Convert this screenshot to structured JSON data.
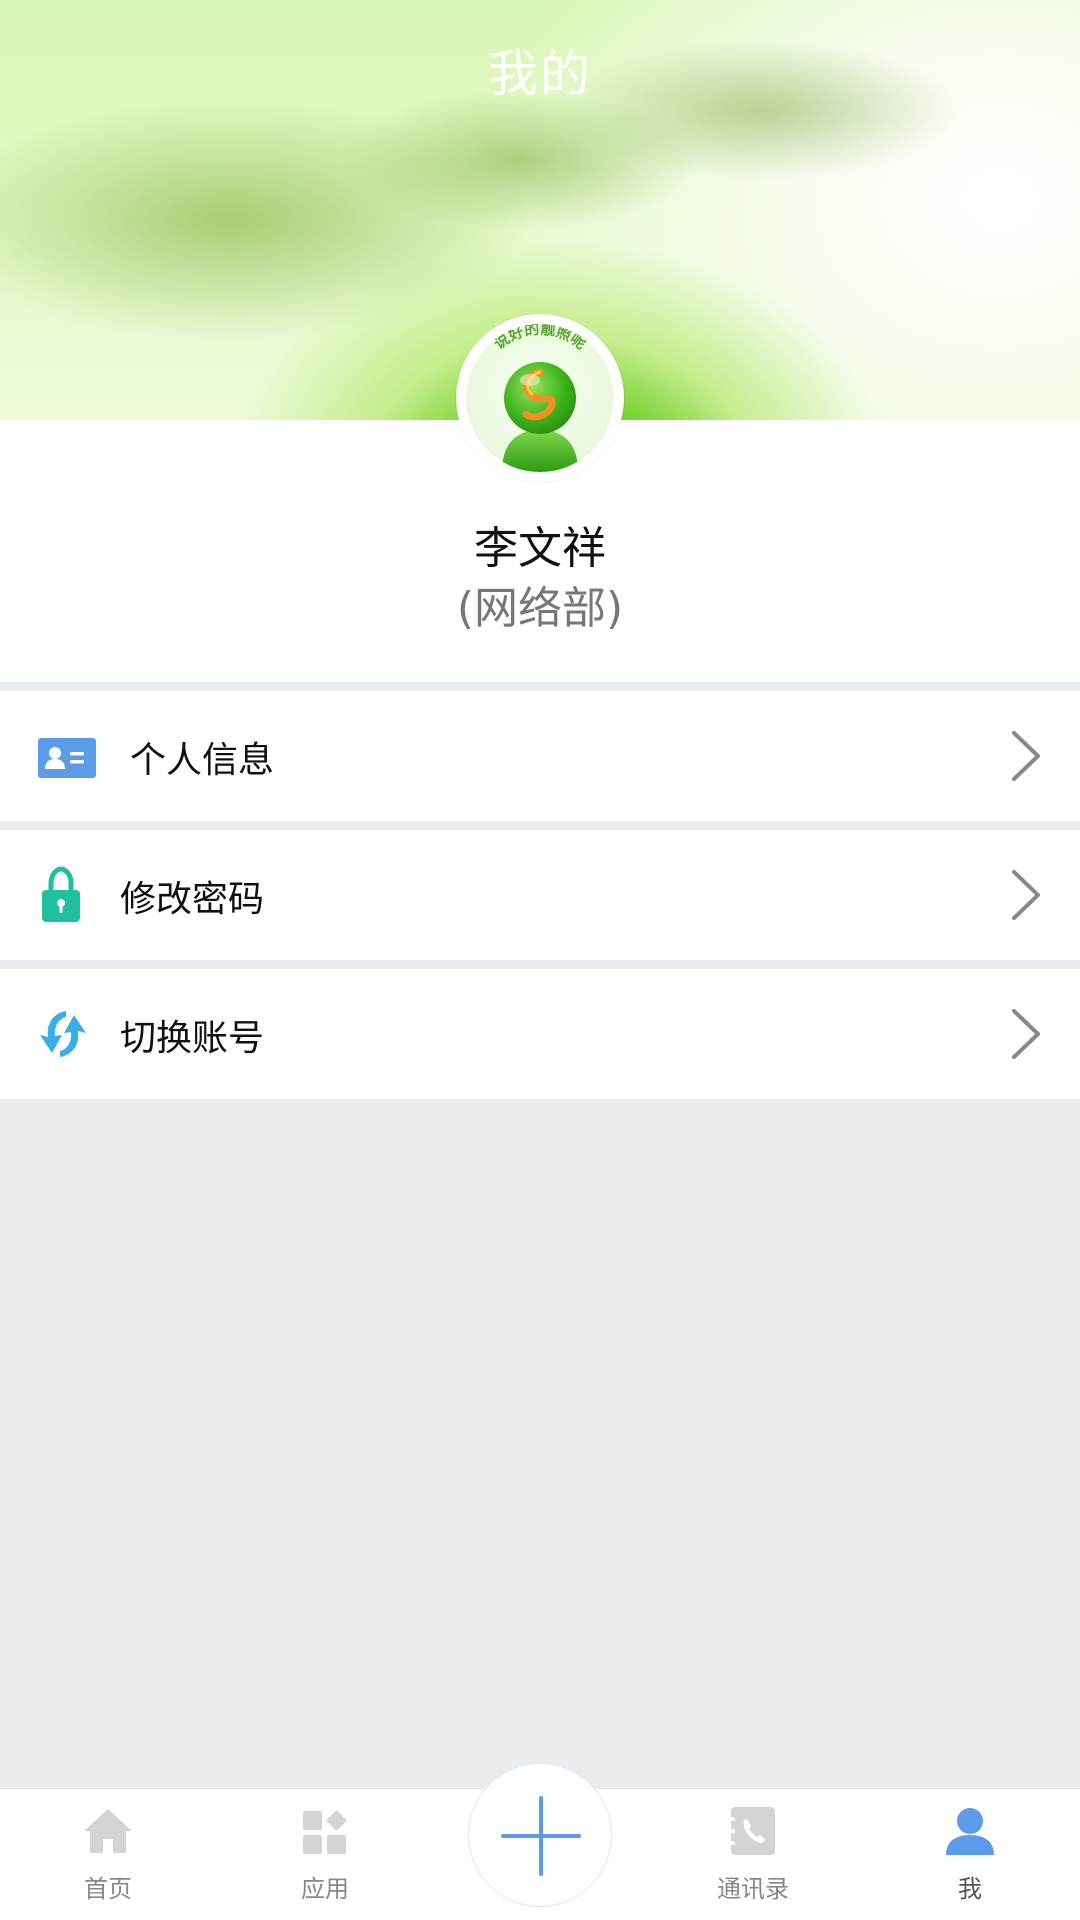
{
  "header": {
    "title": "我的"
  },
  "profile": {
    "avatar_caption": "说好的靓照呢",
    "name": "李文祥",
    "department": "(网络部)"
  },
  "menu": [
    {
      "label": "个人信息",
      "icon": "id-card-icon",
      "icon_color": "#5b9be8"
    },
    {
      "label": "修改密码",
      "icon": "lock-icon",
      "icon_color": "#1fbfa0"
    },
    {
      "label": "切换账号",
      "icon": "switch-account-icon",
      "icon_color": "#3aaee8"
    }
  ],
  "tabbar": {
    "tabs": [
      {
        "label": "首页",
        "icon": "home-icon"
      },
      {
        "label": "应用",
        "icon": "apps-icon"
      },
      {
        "label": "通讯录",
        "icon": "contacts-icon"
      },
      {
        "label": "我",
        "icon": "user-icon",
        "active": true
      }
    ],
    "center_button": "plus-icon",
    "active_color": "#5b9be8",
    "inactive_color": "#d4d4d4"
  }
}
